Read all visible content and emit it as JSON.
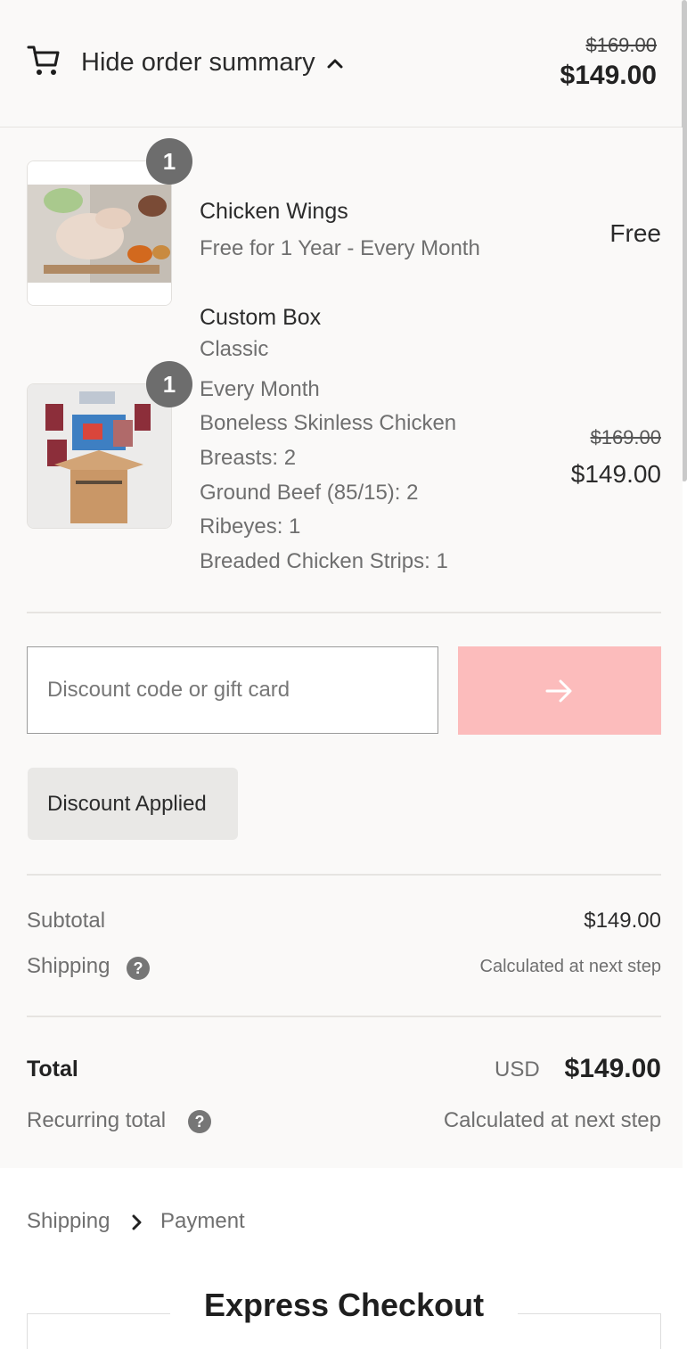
{
  "header": {
    "toggle_label": "Hide order summary",
    "compare_total": "$169.00",
    "total": "$149.00"
  },
  "items": [
    {
      "name": "Chicken Wings",
      "quantity": "1",
      "details": [
        "Free for 1 Year - Every Month"
      ],
      "price": "Free"
    },
    {
      "name": "Custom Box",
      "quantity": "1",
      "details": [
        "Classic",
        "Every Month",
        "Boneless Skinless Chicken",
        "Breasts: 2",
        "Ground Beef (85/15): 2",
        "Ribeyes: 1",
        "Breaded Chicken Strips: 1"
      ],
      "compare_price": "$169.00",
      "price": "$149.00"
    }
  ],
  "discount": {
    "placeholder": "Discount code or gift card",
    "applied_label": "Discount Applied"
  },
  "totals": {
    "subtotal_label": "Subtotal",
    "subtotal_value": "$149.00",
    "shipping_label": "Shipping",
    "shipping_value": "Calculated at next step",
    "total_label": "Total",
    "currency": "USD",
    "total_value": "$149.00",
    "recurring_label": "Recurring total",
    "recurring_value": "Calculated at next step"
  },
  "breadcrumb": {
    "step1": "Shipping",
    "step2": "Payment"
  },
  "express": {
    "title": "Express Checkout"
  },
  "colors": {
    "summary_bg": "#faf9f8",
    "apply_button": "#fcbcbc",
    "badge": "#6d6d6d"
  }
}
